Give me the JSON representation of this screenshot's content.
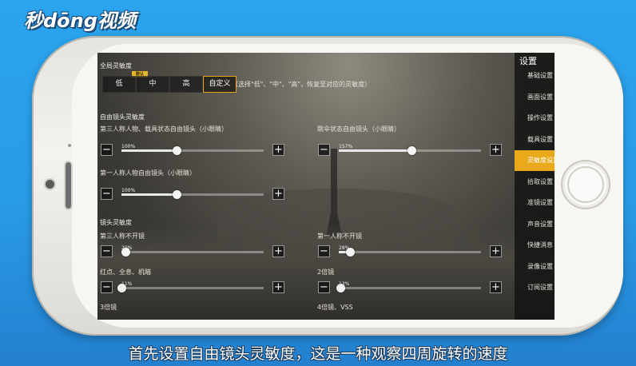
{
  "watermark": "秒dōng视频",
  "caption": "首先设置自由镜头灵敏度，这是一种观察四周旋转的速度",
  "colors": {
    "accent": "#e9a91a",
    "background": "#2aa4ee"
  },
  "screen": {
    "global_section": {
      "title": "全局灵敏度",
      "default_badge": "默认",
      "presets": [
        {
          "label": "低",
          "active": false
        },
        {
          "label": "中",
          "active": false
        },
        {
          "label": "高",
          "active": false
        },
        {
          "label": "自定义",
          "active": true
        }
      ],
      "hint": "（选择\"低\"、\"中\"、\"高\"，恢复至对应的灵敏度）"
    },
    "free_camera_section": {
      "title": "自由镜头灵敏度",
      "sliders": [
        {
          "label": "第三人称人物、载具状态自由镜头（小眼睛）",
          "value_text": "100%",
          "level": 0.39
        },
        {
          "label": "跳伞状态自由镜头（小眼睛）",
          "value_text": "157%",
          "level": 0.51
        },
        {
          "label": "第一人称人物自由镜头（小眼睛）",
          "value_text": "100%",
          "level": 0.39
        }
      ]
    },
    "scope_section": {
      "title": "镜头灵敏度",
      "sliders": [
        {
          "label": "第三人称不开镜",
          "value_text": "20%",
          "level": 0.03
        },
        {
          "label": "第一人称不开镜",
          "value_text": "28%",
          "level": 0.08
        },
        {
          "label": "红点、全息、机瞄",
          "value_text": "11%",
          "level": 0.0
        },
        {
          "label": "2倍镜",
          "value_text": "13%",
          "level": 0.01
        }
      ],
      "more": [
        "3倍镜",
        "4倍镜、VSS"
      ]
    },
    "minus_symbol": "−",
    "plus_symbol": "+",
    "menu": {
      "title": "设置",
      "items": [
        {
          "label": "基础设置",
          "active": false
        },
        {
          "label": "画面设置",
          "active": false
        },
        {
          "label": "操作设置",
          "active": false
        },
        {
          "label": "载具设置",
          "active": false
        },
        {
          "label": "灵敏度设置",
          "active": true
        },
        {
          "label": "拾取设置",
          "active": false
        },
        {
          "label": "准镜设置",
          "active": false
        },
        {
          "label": "声音设置",
          "active": false
        },
        {
          "label": "快捷消息",
          "active": false
        },
        {
          "label": "录像设置",
          "active": false
        },
        {
          "label": "订阅设置",
          "active": false
        }
      ]
    }
  }
}
